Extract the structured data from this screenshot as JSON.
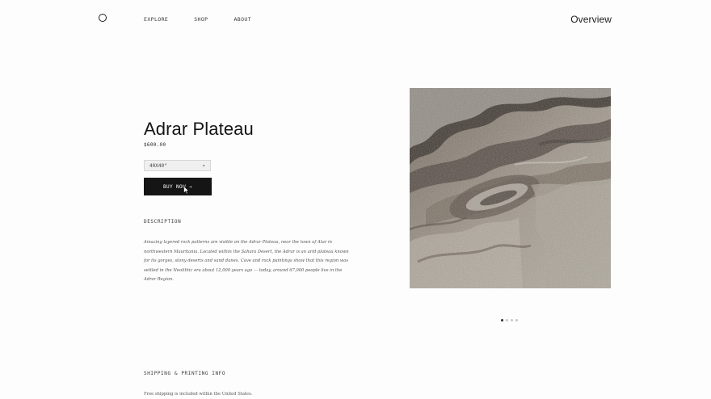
{
  "nav": {
    "items": [
      {
        "label": "EXPLORE"
      },
      {
        "label": "SHOP"
      },
      {
        "label": "ABOUT"
      }
    ],
    "page_title": "Overview"
  },
  "product": {
    "title": "Adrar Plateau",
    "price": "$600.00",
    "size_selected": "40X40\"",
    "buy_label": "BUY NOW →",
    "image_name": "satellite-image-adrar-plateau"
  },
  "description": {
    "label": "DESCRIPTION",
    "text": "Amazing layered rock patterns are visible on the Adrar Plateau, near the town of Atar in northwestern Mauritania. Located within the Sahara Desert, the Adrar is an arid plateau known for its gorges, stony deserts and sand dunes. Cave and rock paintings show that this region was settled in the Neolithic era about 12,000 years ago — today, around 67,000 people live in the Adrar Region."
  },
  "shipping": {
    "label": "SHIPPING & PRINTING INFO",
    "text": "Free shipping is included within the United States."
  },
  "carousel": {
    "count": 4,
    "active_index": 0
  },
  "colors": {
    "background": "#fdfdfd",
    "button": "#151515",
    "text": "#1b1b1b"
  }
}
